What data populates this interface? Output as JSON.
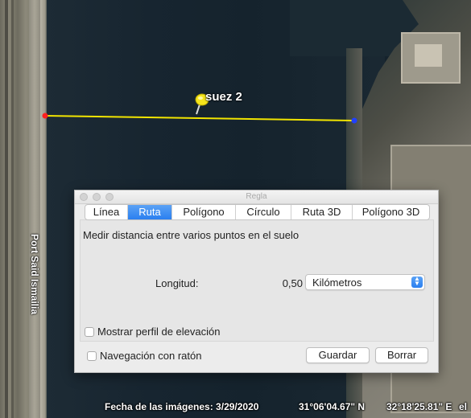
{
  "map": {
    "road_label": "Port Said Ismailia",
    "placemark_label": "suez 2"
  },
  "status_bar": {
    "imagery_date": "Fecha de las imágenes: 3/29/2020",
    "latitude": "31°06'04.67\" N",
    "longitude": "32°18'25.81\" E",
    "trailing": "el"
  },
  "dialog": {
    "title": "Regla",
    "tabs": [
      {
        "label": "Línea",
        "active": false
      },
      {
        "label": "Ruta",
        "active": true
      },
      {
        "label": "Polígono",
        "active": false
      },
      {
        "label": "Círculo",
        "active": false
      },
      {
        "label": "Ruta 3D",
        "active": false
      },
      {
        "label": "Polígono 3D",
        "active": false
      }
    ],
    "description": "Medir distancia entre varios puntos en el suelo",
    "length_label": "Longitud:",
    "length_value": "0,50",
    "unit": "Kilómetros",
    "elevation_profile_label": "Mostrar perfil de elevación",
    "mouse_navigation_label": "Navegación con ratón",
    "save_label": "Guardar",
    "clear_label": "Borrar"
  },
  "colors": {
    "measure_line": "#f2e500",
    "start_point": "#ff2020",
    "end_point": "#2040ff",
    "accent": "#2a7ff0"
  }
}
